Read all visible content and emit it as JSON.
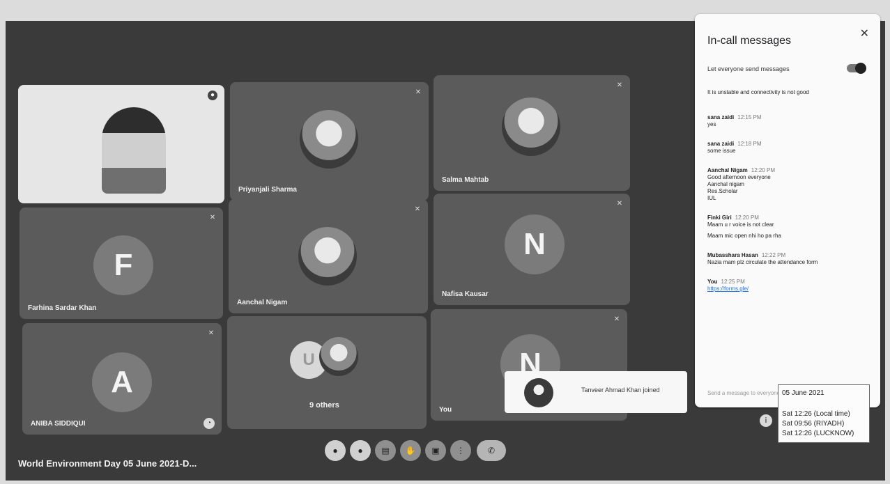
{
  "panel": {
    "title": "In-call messages",
    "toggle_label": "Let everyone send messages",
    "system_note": "It is unstable and connectivity is not good",
    "messages": [
      {
        "sender": "sana zaidi",
        "time": "12:15 PM",
        "lines": [
          "yes"
        ]
      },
      {
        "sender": "sana zaidi",
        "time": "12:18 PM",
        "lines": [
          "some issue"
        ]
      },
      {
        "sender": "Aanchal Nigam",
        "time": "12:20 PM",
        "lines": [
          "Good afternoon everyone",
          "Aanchal nigam",
          "Res.Scholar",
          "IUL"
        ]
      },
      {
        "sender": "Finki Giri",
        "time": "12:20 PM",
        "lines": [
          "Maam u r voice is not clear",
          "Maam mic open nhi ho pa rha"
        ]
      },
      {
        "sender": "Mubasshara Hasan",
        "time": "12:22 PM",
        "lines": [
          "Nazia mam plz circulate the attendance form"
        ]
      },
      {
        "sender": "You",
        "time": "12:25 PM",
        "lines": [
          "https://forms.gle/"
        ],
        "link": true
      }
    ],
    "send_placeholder": "Send a message to everyone"
  },
  "tiles": {
    "t2": "Priyanjali Sharma",
    "t3": "Salma Mahtab",
    "t4": "Farhina Sardar Khan",
    "t5": "Aanchal Nigam",
    "t6": "Nafisa Kausar",
    "t7": "ANIBA SIDDIQUI",
    "t8": "9 others",
    "t9": "You",
    "letters": {
      "t4": "F",
      "t6": "N",
      "t7": "A",
      "t9": "N",
      "others_u": "U"
    }
  },
  "toast": {
    "text": "Tanveer Ahmad Khan joined"
  },
  "clock": {
    "date": "05 June 2021",
    "line1": "Sat 12:26  (Local time)",
    "line2": "Sat 09:56  (RIYADH)",
    "line3": "Sat 12:26  (LUCKNOW)"
  },
  "meeting": {
    "title": "World Environment Day 05 June 2021-D..."
  },
  "icons": [
    "mic-icon",
    "camera-icon",
    "captions-icon",
    "raise-hand-icon",
    "present-icon",
    "more-icon",
    "end-call-icon",
    "info-icon",
    "close-icon"
  ]
}
